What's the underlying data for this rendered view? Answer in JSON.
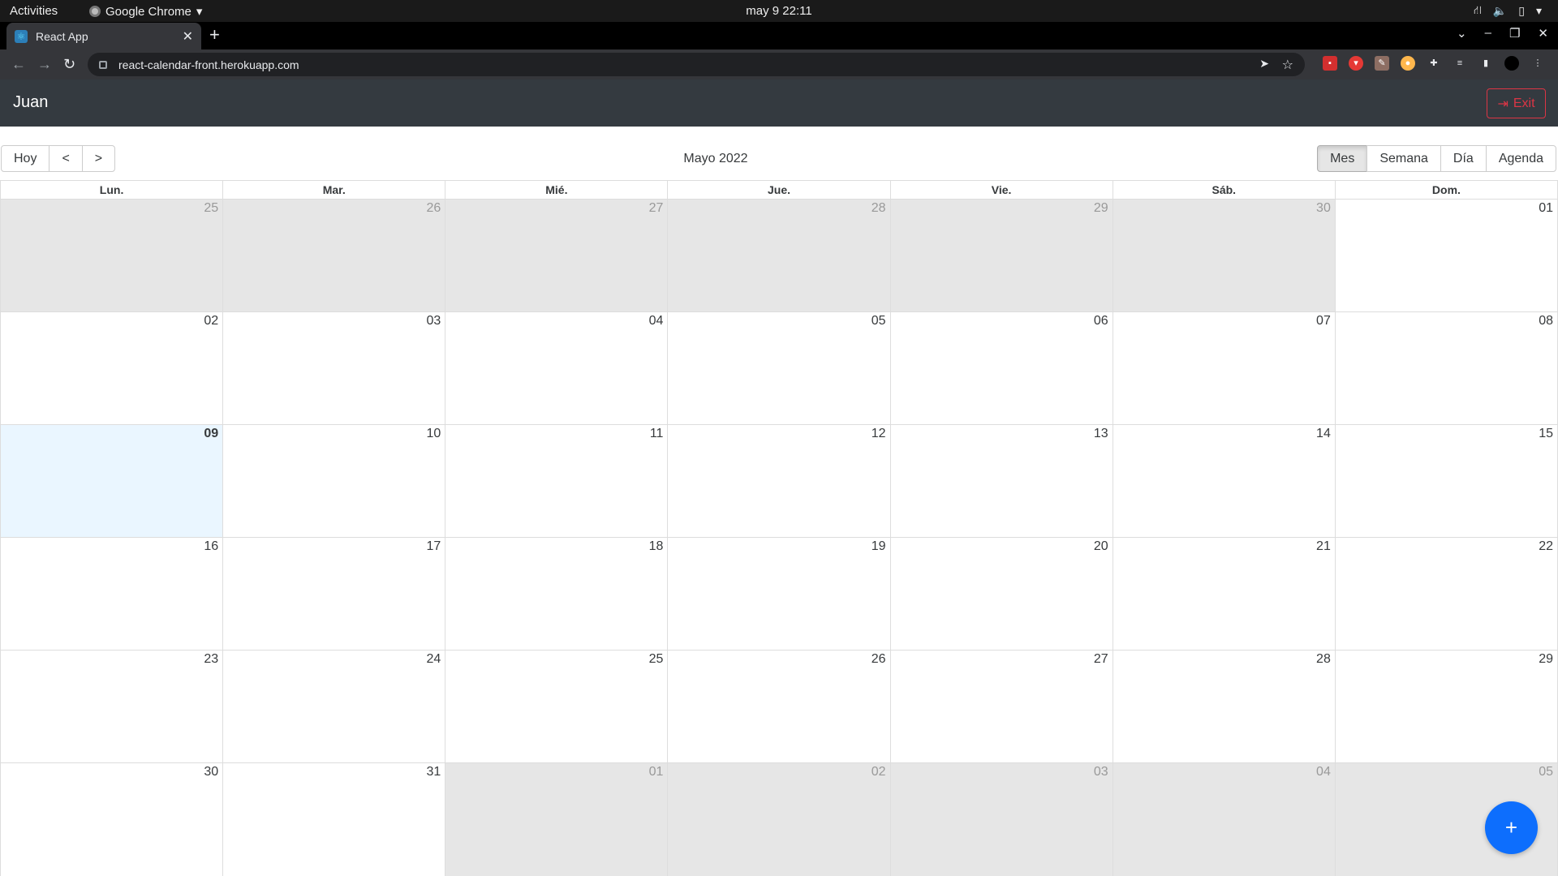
{
  "os": {
    "activities": "Activities",
    "app_menu": "Google Chrome",
    "clock": "may 9  22:11"
  },
  "browser": {
    "tab_title": "React App",
    "url": "react-calendar-front.herokuapp.com"
  },
  "app": {
    "user_name": "Juan",
    "exit_label": "Exit"
  },
  "calendar": {
    "nav": {
      "today": "Hoy",
      "prev": "<",
      "next": ">"
    },
    "title": "Mayo 2022",
    "views": [
      {
        "label": "Mes",
        "active": true
      },
      {
        "label": "Semana",
        "active": false
      },
      {
        "label": "Día",
        "active": false
      },
      {
        "label": "Agenda",
        "active": false
      }
    ],
    "weekdays": [
      "Lun.",
      "Mar.",
      "Mié.",
      "Jue.",
      "Vie.",
      "Sáb.",
      "Dom."
    ],
    "weeks": [
      [
        {
          "d": "25",
          "off": true
        },
        {
          "d": "26",
          "off": true
        },
        {
          "d": "27",
          "off": true
        },
        {
          "d": "28",
          "off": true
        },
        {
          "d": "29",
          "off": true
        },
        {
          "d": "30",
          "off": true
        },
        {
          "d": "01"
        }
      ],
      [
        {
          "d": "02"
        },
        {
          "d": "03"
        },
        {
          "d": "04"
        },
        {
          "d": "05"
        },
        {
          "d": "06"
        },
        {
          "d": "07"
        },
        {
          "d": "08"
        }
      ],
      [
        {
          "d": "09",
          "today": true
        },
        {
          "d": "10"
        },
        {
          "d": "11"
        },
        {
          "d": "12"
        },
        {
          "d": "13"
        },
        {
          "d": "14"
        },
        {
          "d": "15"
        }
      ],
      [
        {
          "d": "16"
        },
        {
          "d": "17"
        },
        {
          "d": "18"
        },
        {
          "d": "19"
        },
        {
          "d": "20"
        },
        {
          "d": "21"
        },
        {
          "d": "22"
        }
      ],
      [
        {
          "d": "23"
        },
        {
          "d": "24"
        },
        {
          "d": "25"
        },
        {
          "d": "26"
        },
        {
          "d": "27"
        },
        {
          "d": "28"
        },
        {
          "d": "29"
        }
      ],
      [
        {
          "d": "30"
        },
        {
          "d": "31"
        },
        {
          "d": "01",
          "off": true
        },
        {
          "d": "02",
          "off": true
        },
        {
          "d": "03",
          "off": true
        },
        {
          "d": "04",
          "off": true
        },
        {
          "d": "05",
          "off": true
        }
      ]
    ]
  },
  "fab": {
    "label": "+"
  },
  "colors": {
    "navbar": "#343a40",
    "danger": "#dc3545",
    "primary": "#0d6efd",
    "off_range": "#e6e6e6",
    "today": "#eaf6ff"
  }
}
